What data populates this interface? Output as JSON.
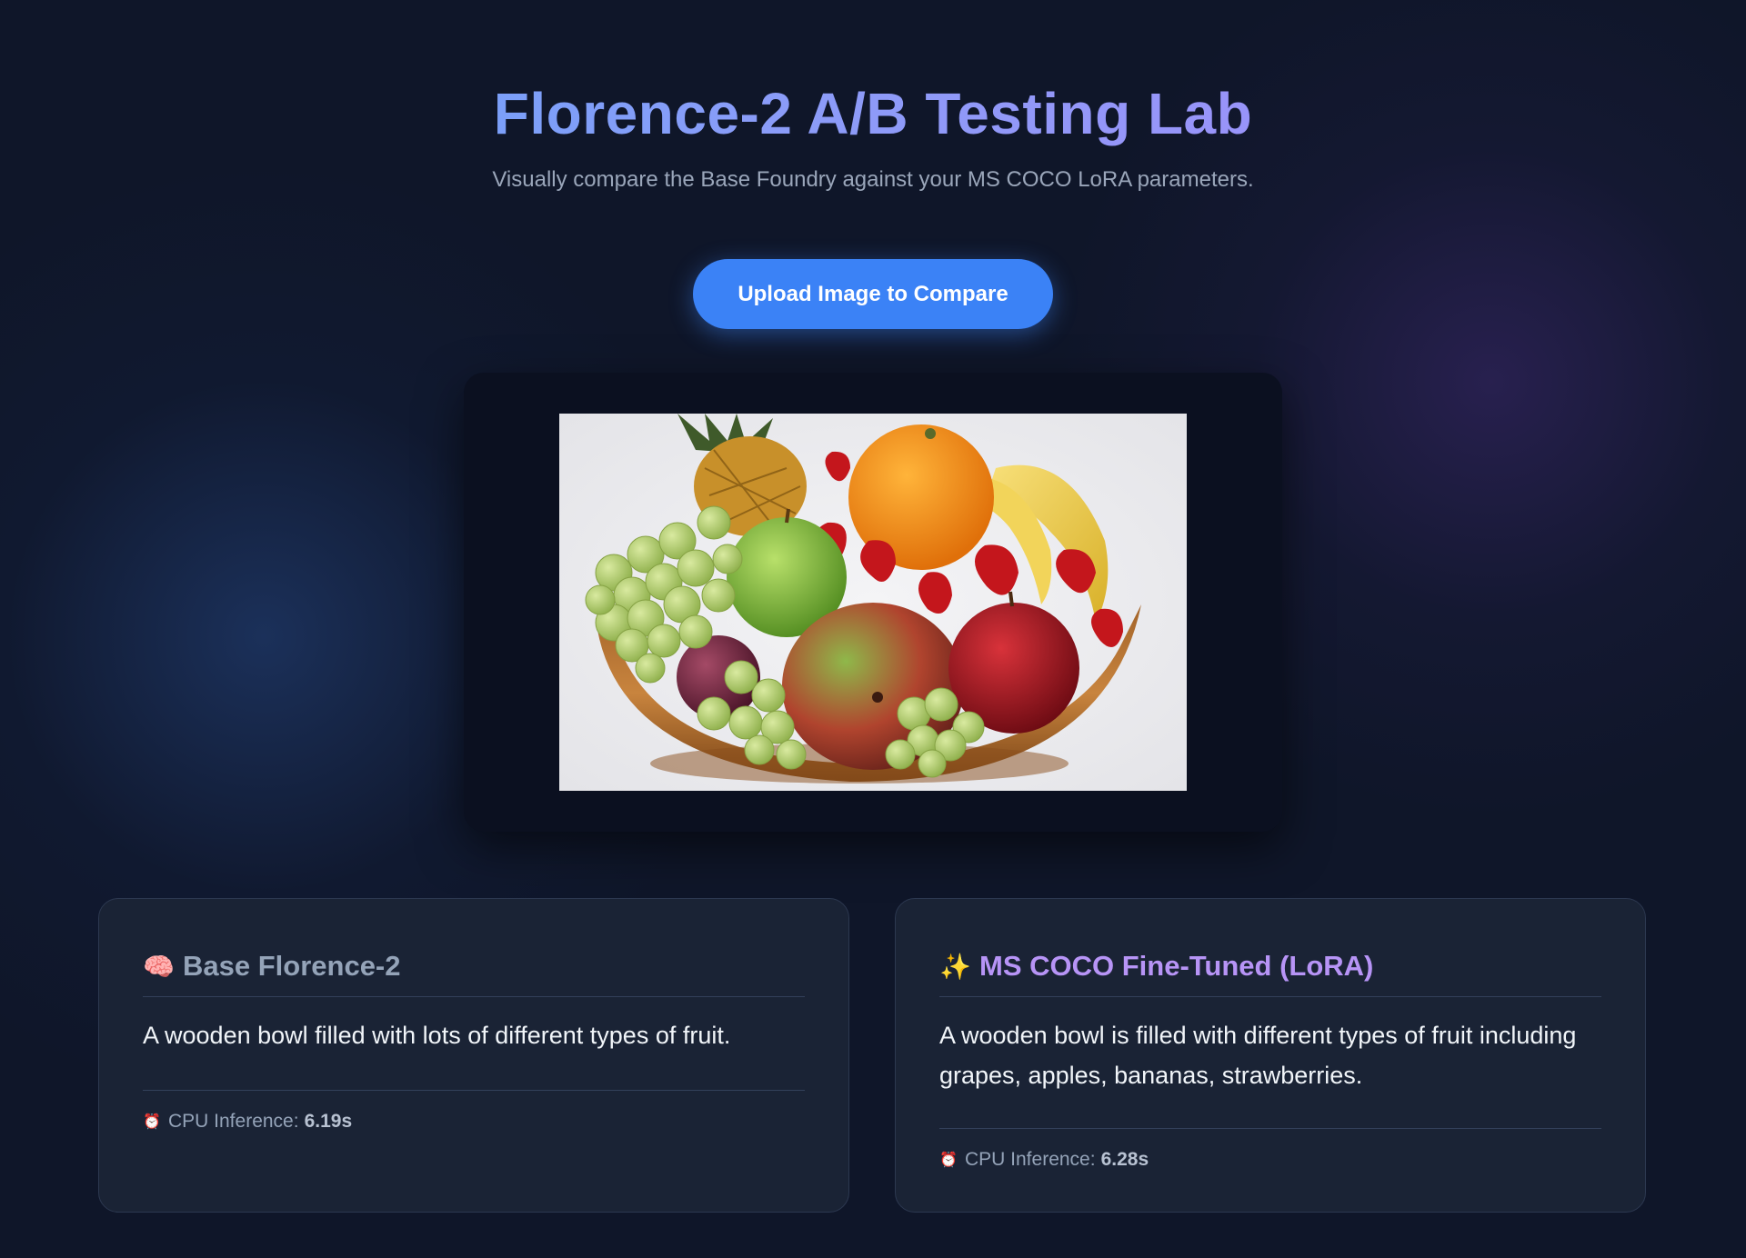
{
  "header": {
    "title": "Florence-2 A/B Testing Lab",
    "subtitle": "Visually compare the Base Foundry against your MS COCO LoRA parameters."
  },
  "upload": {
    "label": "Upload Image to Compare"
  },
  "preview": {
    "image_description_icon": "fruit-bowl-image"
  },
  "cards": {
    "base": {
      "icon": "🧠",
      "title": "Base Florence-2",
      "caption": "A wooden bowl filled with lots of different types of fruit.",
      "metric_icon": "⏰",
      "metric_label": "CPU Inference:",
      "metric_value": "6.19s"
    },
    "lora": {
      "icon": "✨",
      "title": "MS COCO Fine-Tuned (LoRA)",
      "caption": "A wooden bowl is filled with different types of fruit including grapes, apples, bananas, strawberries.",
      "metric_icon": "⏰",
      "metric_label": "CPU Inference:",
      "metric_value": "6.28s"
    }
  },
  "colors": {
    "accent": "#3b82f6",
    "title_gradient_start": "#60a5fa",
    "title_gradient_end": "#a78bfa",
    "lora_title": "#b794f6",
    "base_title": "#94a3b8"
  }
}
